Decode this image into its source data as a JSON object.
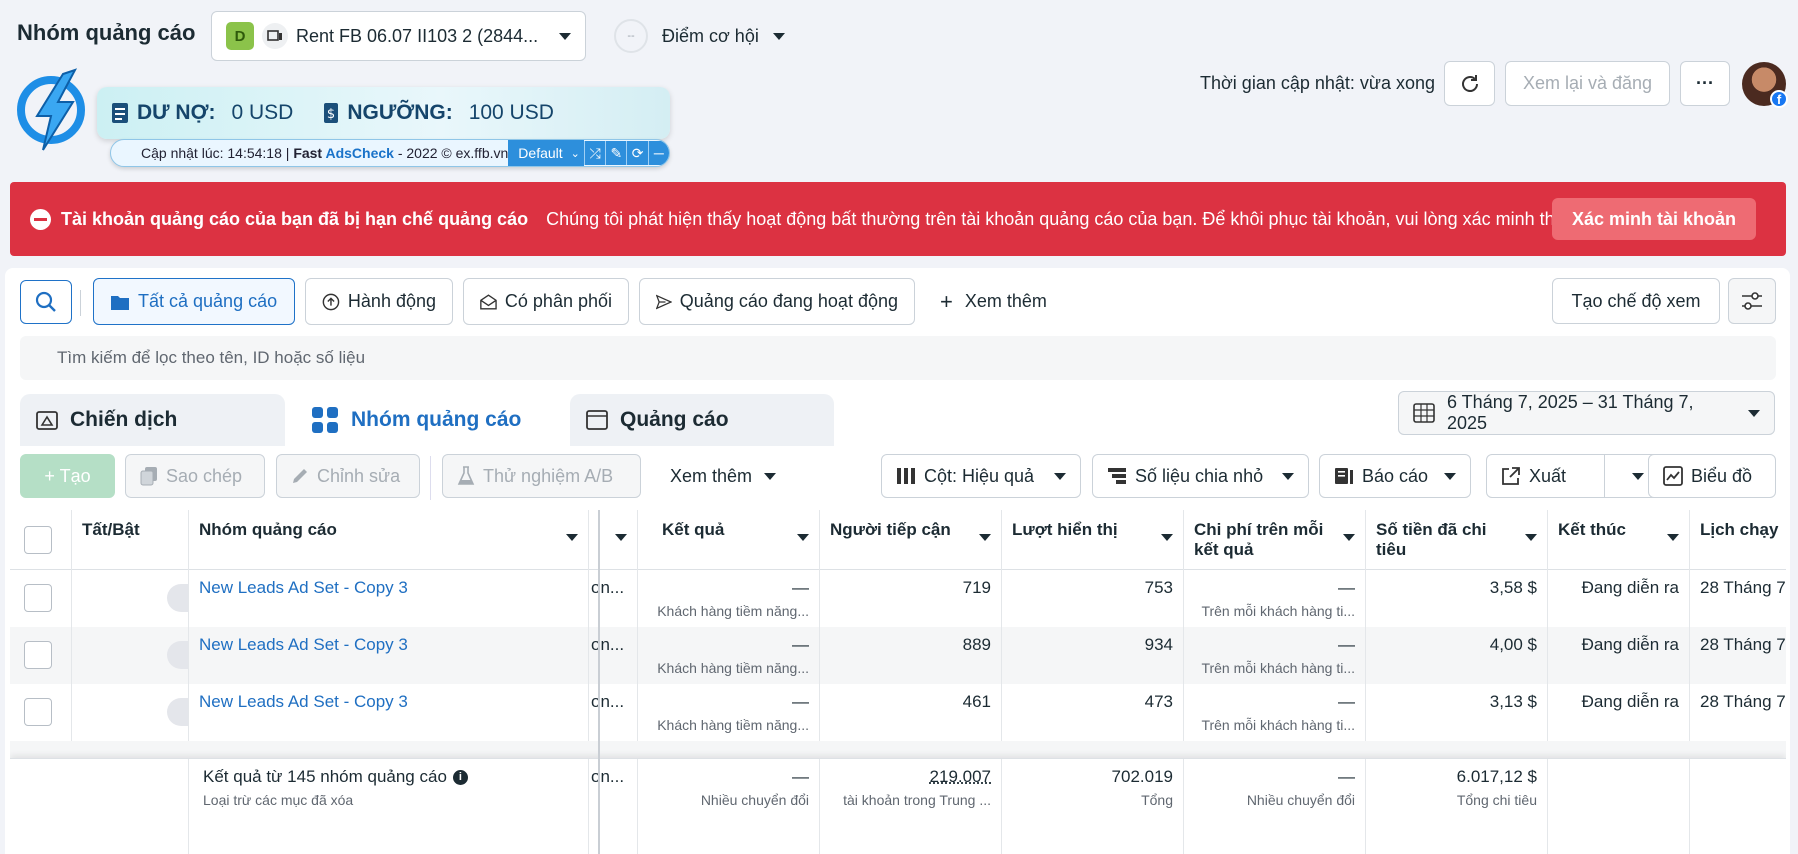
{
  "header": {
    "title": "Nhóm quảng cáo",
    "account_badge": "D",
    "account_name": "Rent FB 06.07 II103 2 (2844...",
    "opportunity_score": "--",
    "opportunity_label": "Điểm cơ hội",
    "update_time": "Thời gian cập nhật: vừa xong",
    "review_publish": "Xem lại và đăng",
    "more": "···"
  },
  "widget": {
    "debt_label": "DƯ NỢ:",
    "debt_value": "0 USD",
    "threshold_label": "NGƯỠNG:",
    "threshold_value": "100 USD",
    "info_prefix": "Cập nhật lúc: 14:54:18 | ",
    "info_brand1": "Fast ",
    "info_brand2": "AdsCheck",
    "info_suffix": " - 2022 © ex.ffb.vn",
    "profile": "Default"
  },
  "alert": {
    "title": "Tài khoản quảng cáo của bạn đã bị hạn chế quảng cáo",
    "message": "Chúng tôi phát hiện thấy hoạt động bất thường trên tài khoản quảng cáo của bạn. Để khôi phục tài khoản, vui lòng xác minh thô...",
    "button": "Xác minh tài khoản"
  },
  "filters": {
    "all_ads": "Tất cả quảng cáo",
    "actions": "Hành động",
    "delivering": "Có phân phối",
    "active_ads": "Quảng cáo đang hoạt động",
    "see_more": "Xem thêm",
    "create_view": "Tạo chế độ xem"
  },
  "search": {
    "placeholder": "Tìm kiếm để lọc theo tên, ID hoặc số liệu"
  },
  "tabs": {
    "campaigns": "Chiến dịch",
    "adsets": "Nhóm quảng cáo",
    "ads": "Quảng cáo"
  },
  "date_range": "6 Tháng 7, 2025 – 31 Tháng 7, 2025",
  "toolbar": {
    "create": "+ Tạo",
    "duplicate": "Sao chép",
    "edit": "Chỉnh sửa",
    "ab_test": "Thử nghiệm A/B",
    "more": "Xem thêm",
    "columns": "Cột: Hiệu quả",
    "breakdown": "Số liệu chia nhỏ",
    "reports": "Báo cáo",
    "export": "Xuất",
    "charts": "Biểu đồ"
  },
  "table": {
    "headers": {
      "toggle": "Tất/Bật",
      "name": "Nhóm quảng cáo",
      "results": "Kết quả",
      "reach": "Người tiếp cận",
      "impressions": "Lượt hiển thị",
      "cost_per_result": "Chi phí trên mỗi kết quả",
      "amount_spent": "Số tiền đã chi tiêu",
      "ends": "Kết thúc",
      "schedule": "Lịch chạy"
    },
    "rows": [
      {
        "name": "New Leads Ad Set - Copy 3",
        "delivery": "on...",
        "result": "—",
        "result_sub": "Khách hàng tiềm năng...",
        "reach": "719",
        "impressions": "753",
        "cpr": "—",
        "cpr_sub": "Trên mỗi khách hàng ti...",
        "spent": "3,58 $",
        "ends": "Đang diễn ra",
        "schedule": "28 Tháng 7"
      },
      {
        "name": "New Leads Ad Set - Copy 3",
        "delivery": "on...",
        "result": "—",
        "result_sub": "Khách hàng tiềm năng...",
        "reach": "889",
        "impressions": "934",
        "cpr": "—",
        "cpr_sub": "Trên mỗi khách hàng ti...",
        "spent": "4,00 $",
        "ends": "Đang diễn ra",
        "schedule": "28 Tháng 7"
      },
      {
        "name": "New Leads Ad Set - Copy 3",
        "delivery": "on...",
        "result": "—",
        "result_sub": "Khách hàng tiềm năng...",
        "reach": "461",
        "impressions": "473",
        "cpr": "—",
        "cpr_sub": "Trên mỗi khách hàng ti...",
        "spent": "3,13 $",
        "ends": "Đang diễn ra",
        "schedule": "28 Tháng 7"
      }
    ],
    "footer": {
      "label": "Kết quả từ 145 nhóm quảng cáo",
      "sub": "Loại trừ các mục đã xóa",
      "delivery": "on...",
      "result": "—",
      "result_sub": "Nhiều chuyển đổi",
      "reach": "219.007",
      "reach_sub": "tài khoản trong Trung ...",
      "impressions": "702.019",
      "impressions_sub": "Tổng",
      "cpr": "—",
      "cpr_sub": "Nhiều chuyển đổi",
      "spent": "6.017,12 $",
      "spent_sub": "Tổng chi tiêu"
    }
  },
  "colors": {
    "accent": "#1f6fc2",
    "alert": "#dc3242",
    "badge": "#8bc34a"
  },
  "icons": [
    "search-icon",
    "folder-icon",
    "upload-icon",
    "envelope-icon",
    "send-icon",
    "plus-icon",
    "sliders-icon",
    "campaign-icon",
    "grid-icon",
    "ad-icon",
    "calendar-icon",
    "copy-icon",
    "pencil-icon",
    "flask-icon",
    "columns-icon",
    "breakdown-icon",
    "report-icon",
    "export-icon",
    "chart-icon",
    "refresh-icon",
    "info-icon"
  ]
}
